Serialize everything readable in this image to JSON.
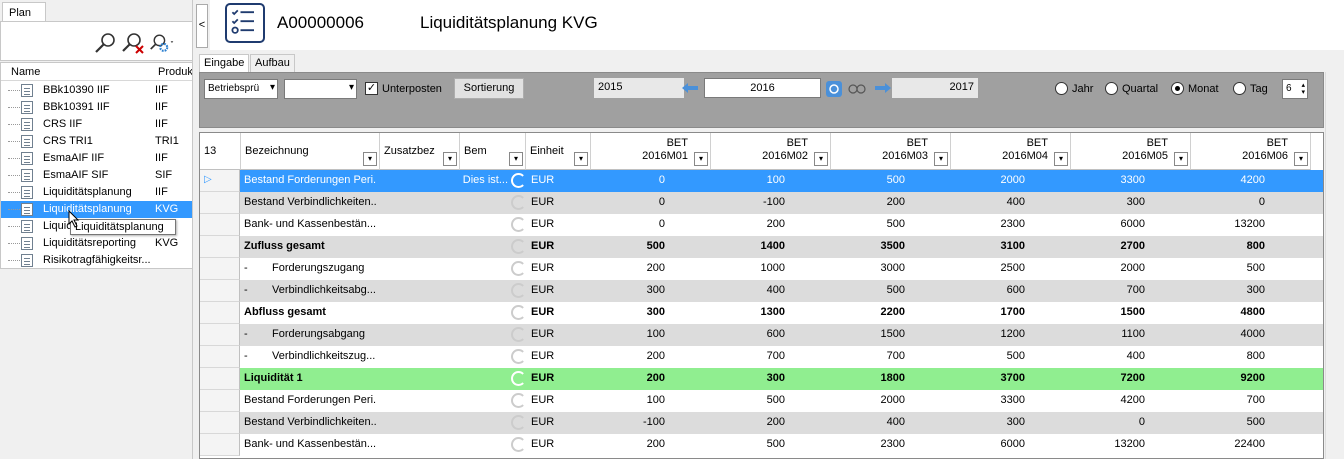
{
  "left": {
    "tab": "Plan",
    "columns": {
      "name": "Name",
      "product": "Produkt"
    },
    "items": [
      {
        "name": "BBk10390 IIF",
        "product": "IIF"
      },
      {
        "name": "BBk10391 IIF",
        "product": "IIF"
      },
      {
        "name": "CRS IIF",
        "product": "IIF"
      },
      {
        "name": "CRS TRI1",
        "product": "TRI1"
      },
      {
        "name": "EsmaAIF IIF",
        "product": "IIF"
      },
      {
        "name": "EsmaAIF SIF",
        "product": "SIF"
      },
      {
        "name": "Liquiditätsplanung",
        "product": "IIF"
      },
      {
        "name": "Liquiditätsplanung",
        "product": "KVG"
      },
      {
        "name": "Liquic",
        "product": ""
      },
      {
        "name": "Liquiditätsreporting",
        "product": "KVG"
      },
      {
        "name": "Risikotragfähigkeitsr...",
        "product": ""
      }
    ],
    "tooltip": "Liquiditätsplanung",
    "collapse": "<"
  },
  "header": {
    "code": "A00000006",
    "title": "Liquiditätsplanung KVG"
  },
  "tabs": {
    "eingabe": "Eingabe",
    "aufbau": "Aufbau"
  },
  "toolbar": {
    "combo1": "Betriebsprü",
    "combo2": "",
    "unterposten": "Unterposten",
    "sortierung": "Sortierung",
    "year_prev": "2015",
    "year_cur": "2016",
    "year_next": "2017",
    "radio": {
      "jahr": "Jahr",
      "quartal": "Quartal",
      "monat": "Monat",
      "tag": "Tag"
    },
    "spin": "6"
  },
  "grid": {
    "rowcount": "13",
    "headers": {
      "bez": "Bezeichnung",
      "zus": "Zusatzbez",
      "bem": "Bem",
      "einheit": "Einheit",
      "months": [
        {
          "l1": "BET",
          "l2": "2016M01"
        },
        {
          "l1": "BET",
          "l2": "2016M02"
        },
        {
          "l1": "BET",
          "l2": "2016M03"
        },
        {
          "l1": "BET",
          "l2": "2016M04"
        },
        {
          "l1": "BET",
          "l2": "2016M05"
        },
        {
          "l1": "BET",
          "l2": "2016M06"
        }
      ]
    },
    "rows": [
      {
        "marker": "",
        "bez": "Bestand Forderungen Peri...",
        "bem": "Dies ist...",
        "unit": "EUR",
        "vals": [
          "0",
          "100",
          "500",
          "2000",
          "3300",
          "4200"
        ],
        "style": "sel"
      },
      {
        "marker": "",
        "bez": "Bestand Verbindlichkeiten...",
        "bem": "",
        "unit": "EUR",
        "vals": [
          "0",
          "-100",
          "200",
          "400",
          "300",
          "0"
        ],
        "style": "alt"
      },
      {
        "marker": "",
        "bez": "Bank- und Kassenbestän...",
        "bem": "",
        "unit": "EUR",
        "vals": [
          "0",
          "200",
          "500",
          "2300",
          "6000",
          "13200"
        ],
        "style": ""
      },
      {
        "marker": "",
        "bez": "Zufluss gesamt",
        "bem": "",
        "unit": "EUR",
        "vals": [
          "500",
          "1400",
          "3500",
          "3100",
          "2700",
          "800"
        ],
        "style": "alt bold"
      },
      {
        "marker": "-",
        "bez": "Forderungszugang",
        "bem": "",
        "unit": "EUR",
        "vals": [
          "200",
          "1000",
          "3000",
          "2500",
          "2000",
          "500"
        ],
        "style": ""
      },
      {
        "marker": "-",
        "bez": "Verbindlichkeitsabg...",
        "bem": "",
        "unit": "EUR",
        "vals": [
          "300",
          "400",
          "500",
          "600",
          "700",
          "300"
        ],
        "style": "alt"
      },
      {
        "marker": "",
        "bez": "Abfluss gesamt",
        "bem": "",
        "unit": "EUR",
        "vals": [
          "300",
          "1300",
          "2200",
          "1700",
          "1500",
          "4800"
        ],
        "style": "bold"
      },
      {
        "marker": "-",
        "bez": "Forderungsabgang",
        "bem": "",
        "unit": "EUR",
        "vals": [
          "100",
          "600",
          "1500",
          "1200",
          "1100",
          "4000"
        ],
        "style": "alt"
      },
      {
        "marker": "-",
        "bez": "Verbindlichkeitszug...",
        "bem": "",
        "unit": "EUR",
        "vals": [
          "200",
          "700",
          "700",
          "500",
          "400",
          "800"
        ],
        "style": ""
      },
      {
        "marker": "",
        "bez": "Liquidität 1",
        "bem": "",
        "unit": "EUR",
        "vals": [
          "200",
          "300",
          "1800",
          "3700",
          "7200",
          "9200"
        ],
        "style": "green bold"
      },
      {
        "marker": "",
        "bez": "Bestand Forderungen Peri...",
        "bem": "",
        "unit": "EUR",
        "vals": [
          "100",
          "500",
          "2000",
          "3300",
          "4200",
          "700"
        ],
        "style": ""
      },
      {
        "marker": "",
        "bez": "Bestand Verbindlichkeiten...",
        "bem": "",
        "unit": "EUR",
        "vals": [
          "-100",
          "200",
          "400",
          "300",
          "0",
          "500"
        ],
        "style": "alt"
      },
      {
        "marker": "",
        "bez": "Bank- und Kassenbestän...",
        "bem": "",
        "unit": "EUR",
        "vals": [
          "200",
          "500",
          "2300",
          "6000",
          "13200",
          "22400"
        ],
        "style": ""
      }
    ]
  }
}
